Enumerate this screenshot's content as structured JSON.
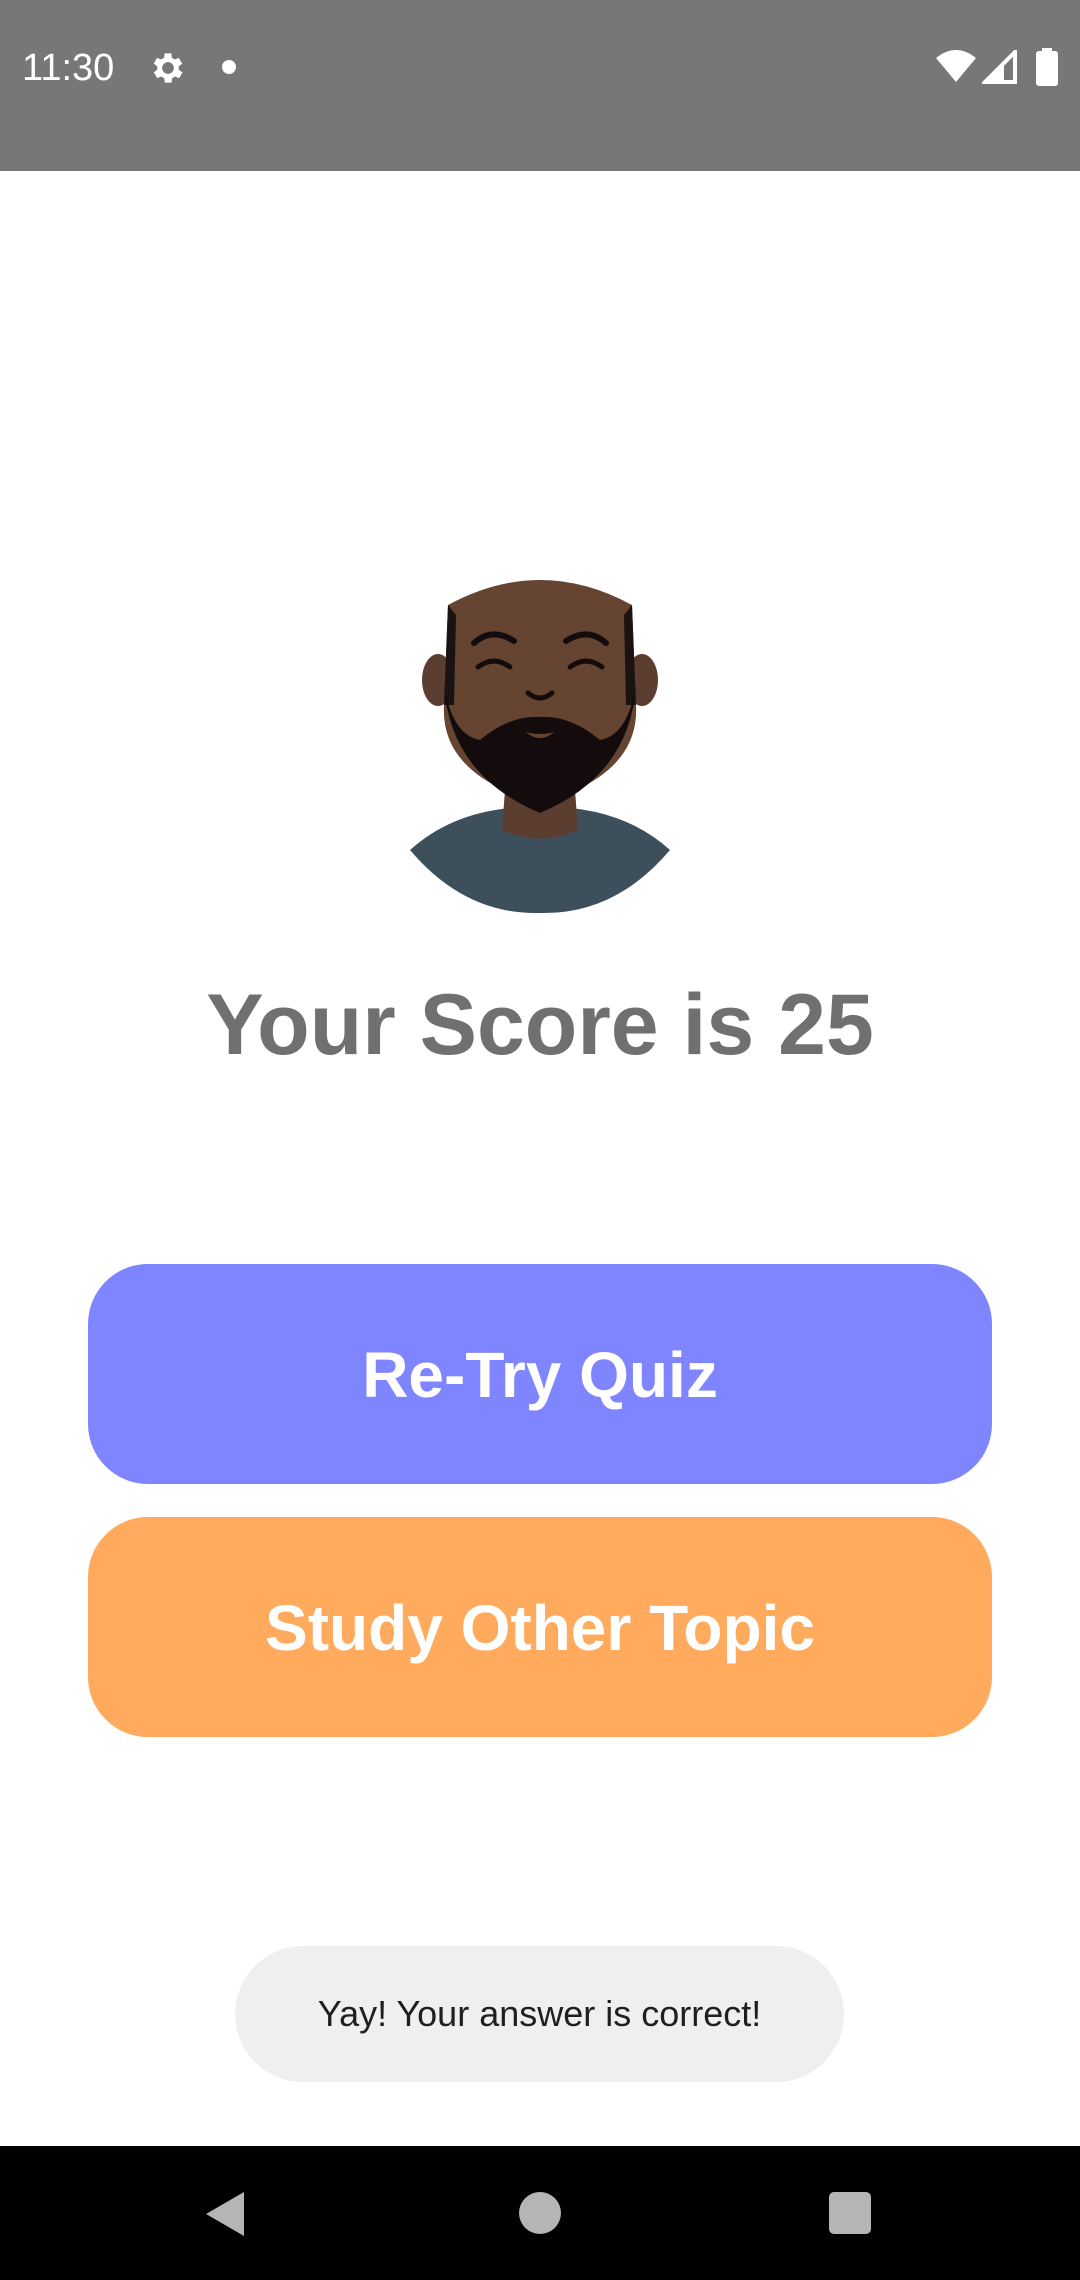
{
  "status_bar": {
    "time": "11:30",
    "icons": [
      "gear-icon",
      "notification-dot-icon",
      "wifi-icon",
      "signal-icon",
      "battery-icon"
    ]
  },
  "result": {
    "score_text": "Your Score is 25"
  },
  "buttons": {
    "retry_label": "Re-Try Quiz",
    "study_label": "Study Other Topic"
  },
  "toast": {
    "message": "Yay! Your answer is correct!"
  },
  "colors": {
    "status_bar": "#777777",
    "retry_button": "#7f85ff",
    "study_button": "#ffaa5c",
    "score_text": "#707070",
    "toast_bg": "#efefef",
    "nav_bar": "#000000"
  },
  "nav_bar": {
    "icons": [
      "back-icon",
      "home-icon",
      "recents-icon"
    ]
  }
}
